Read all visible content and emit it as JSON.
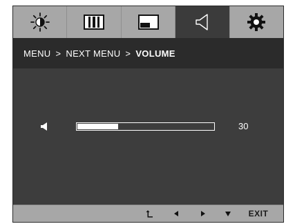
{
  "tabs": [
    {
      "name": "brightness",
      "icon": "sun-icon",
      "active": false
    },
    {
      "name": "picture",
      "icon": "picture-icon",
      "active": false
    },
    {
      "name": "color",
      "icon": "screen-icon",
      "active": false
    },
    {
      "name": "volume",
      "icon": "speaker-outline-icon",
      "active": true
    },
    {
      "name": "settings",
      "icon": "gear-icon",
      "active": false
    }
  ],
  "breadcrumb": {
    "menu": "MENU",
    "separator": ">",
    "next": "NEXT MENU",
    "current": "VOLUME"
  },
  "volume": {
    "icon": "speaker-icon",
    "value": "30",
    "level": 0.3
  },
  "bottom": {
    "return_icon": "return-icon",
    "left_icon": "triangle-left-icon",
    "right_icon": "triangle-right-icon",
    "down_icon": "triangle-down-icon",
    "exit": "EXIT"
  },
  "colors": {
    "tab_bar": "#a7a7a7",
    "osd_background": "#3b3b3b",
    "breadcrumb_background": "#2b2b2b",
    "text": "#ffffff"
  }
}
